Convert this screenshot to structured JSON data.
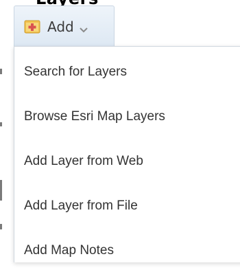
{
  "header_cut_text": "Layers",
  "add_button": {
    "label": "Add"
  },
  "menu": {
    "items": [
      {
        "label": "Search for Layers"
      },
      {
        "label": "Browse Esri Map Layers"
      },
      {
        "label": "Add Layer from Web"
      },
      {
        "label": "Add Layer from File"
      },
      {
        "label": "Add Map Notes"
      }
    ]
  },
  "icons": {
    "add": "add-layer-icon",
    "caret": "chevron-down-icon"
  },
  "colors": {
    "button_bg": "#e3edf7",
    "menu_text": "#333333",
    "icon_yellow": "#f2c14e",
    "icon_red": "#d9534f"
  }
}
